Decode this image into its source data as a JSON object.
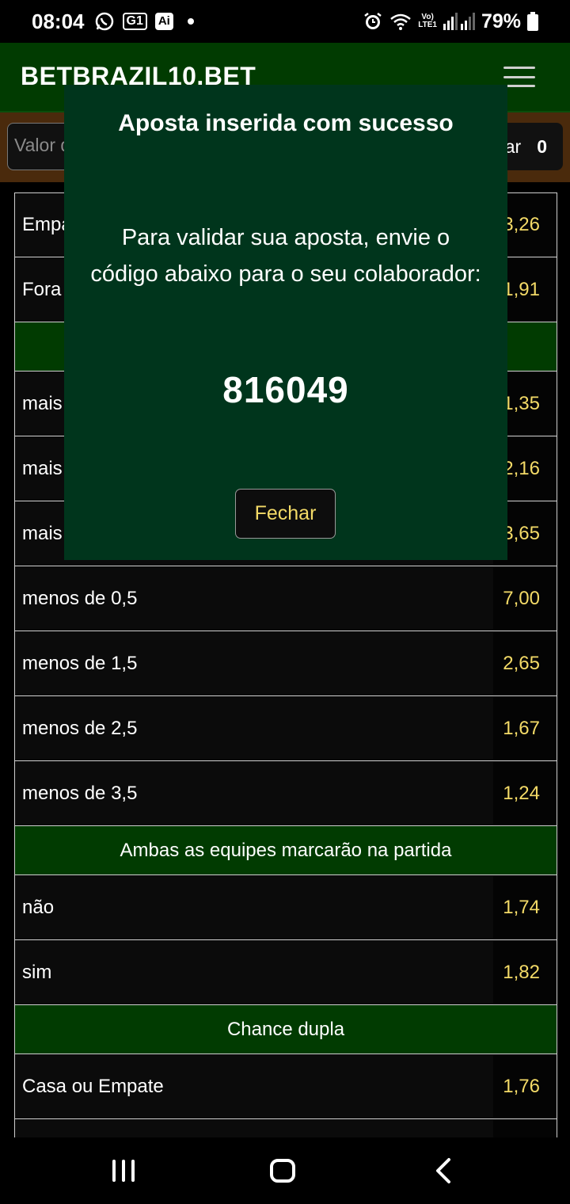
{
  "status_bar": {
    "time": "08:04",
    "notif_g1": "G1",
    "notif_ai": "Ai",
    "network_top": "Vo)",
    "network_bottom": "LTE1",
    "battery": "79%",
    "icons": [
      "whatsapp-icon",
      "g1-icon",
      "ai-icon",
      "alarm-icon",
      "wifi-icon",
      "signal-icon",
      "battery-icon"
    ]
  },
  "header": {
    "brand": "BETBRAZIL10.BET",
    "menu_icon": "hamburger-icon"
  },
  "bet_bar": {
    "value_placeholder": "Valor d",
    "button_label": "ar",
    "count": "0"
  },
  "odds": {
    "rows": [
      {
        "type": "row",
        "label": "Empa",
        "odd": "3,26"
      },
      {
        "type": "row",
        "label": "Fora",
        "odd": "1,91"
      },
      {
        "type": "section",
        "title": ""
      },
      {
        "type": "row",
        "label": "mais",
        "odd": "1,35"
      },
      {
        "type": "row",
        "label": "mais",
        "odd": "2,16"
      },
      {
        "type": "row",
        "label": "mais",
        "odd": "3,65"
      },
      {
        "type": "row",
        "label": "menos de 0,5",
        "odd": "7,00"
      },
      {
        "type": "row",
        "label": "menos de 1,5",
        "odd": "2,65"
      },
      {
        "type": "row",
        "label": "menos de 2,5",
        "odd": "1,67"
      },
      {
        "type": "row",
        "label": "menos de 3,5",
        "odd": "1,24"
      },
      {
        "type": "section",
        "title": "Ambas as equipes marcarão na partida"
      },
      {
        "type": "row",
        "label": "não",
        "odd": "1,74"
      },
      {
        "type": "row",
        "label": "sim",
        "odd": "1,82"
      },
      {
        "type": "section",
        "title": "Chance dupla"
      },
      {
        "type": "row",
        "label": "Casa ou Empate",
        "odd": "1,76"
      },
      {
        "type": "row",
        "label": "",
        "odd": ""
      }
    ]
  },
  "modal": {
    "title": "Aposta inserida com sucesso",
    "message": "Para validar sua aposta, envie o código abaixo para o seu colaborador:",
    "code": "816049",
    "close_label": "Fechar"
  },
  "nav_bar": {
    "icons": [
      "recents-icon",
      "home-icon",
      "back-icon"
    ]
  },
  "colors": {
    "header_green": "#013b01",
    "modal_green": "#00351c",
    "bet_bar_brown": "#4a2a0c",
    "odd_yellow": "#f3da67"
  }
}
